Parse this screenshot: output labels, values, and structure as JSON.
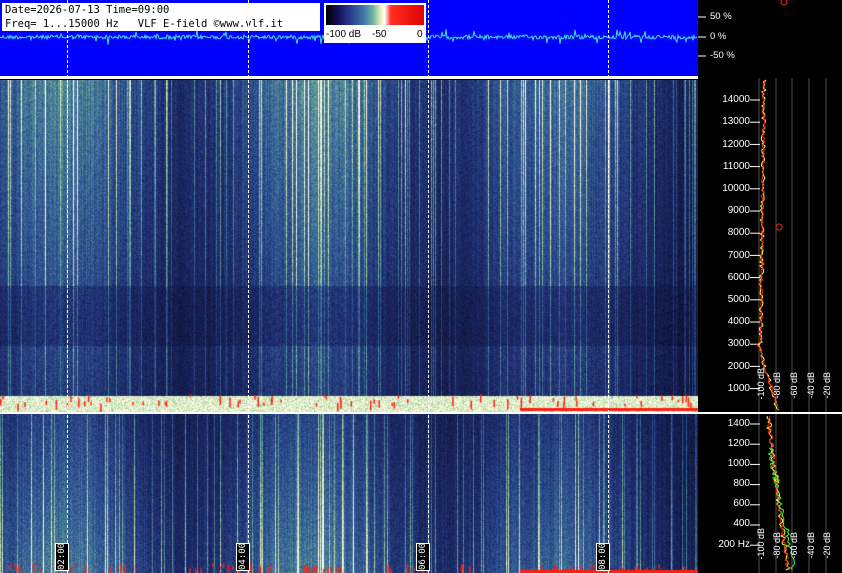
{
  "header": {
    "date_time_line": "Date=2026-07-13 Time=09:00",
    "freq_line": "Freq= 1...15000 Hz   VLF E-field ©www.vlf.it"
  },
  "colorbar": {
    "labels": [
      "-100 dB",
      "-50",
      "0"
    ]
  },
  "amplitude_scale": {
    "labels": [
      "50 %",
      "0 %",
      "-50 %"
    ]
  },
  "upper_freq_axis": {
    "labels": [
      "14000",
      "13000",
      "12000",
      "11000",
      "10000",
      "9000",
      "8000",
      "7000",
      "6000",
      "5000",
      "4000",
      "3000",
      "2000",
      "1000"
    ]
  },
  "lower_freq_axis": {
    "labels": [
      "1400",
      "1200",
      "1000",
      "800",
      "600",
      "400",
      "200 Hz"
    ]
  },
  "spectrum_db_labels": [
    "-100 dB",
    "-80 dB",
    "-60 dB",
    "-40 dB",
    "-20 dB"
  ],
  "time_markers": [
    "02:00",
    "04:00",
    "06:00",
    "08:00"
  ],
  "colors": {
    "waveform_bg": "#0000ff",
    "spectrogram_base": "#1a2660",
    "accent_red": "#ff2010",
    "trace_yellow": "#ffff40",
    "trace_green": "#40ff40"
  }
}
